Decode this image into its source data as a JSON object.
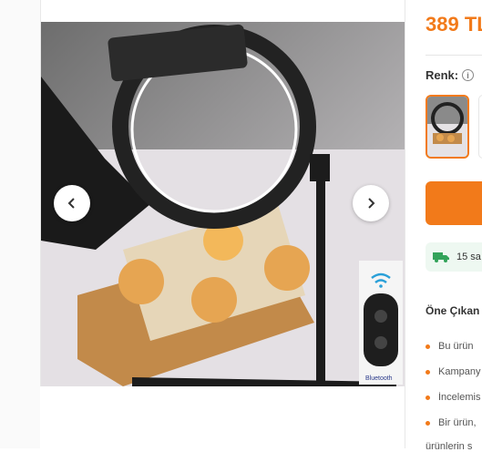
{
  "product": {
    "price": "389 TL",
    "color_label": "Renk:",
    "shipping_text": "15 sa",
    "features_title": "Öne Çıkan",
    "features": [
      "Bu ürün",
      "Kampany",
      "İncelemis",
      "Bir ürün,"
    ],
    "features_tail": "ürünlerin s"
  },
  "gallery": {
    "image_overlay_text": "Bluetooth",
    "prev_icon": "chevron-left-icon",
    "next_icon": "chevron-right-icon"
  },
  "colors": {
    "accent": "#f27a1a",
    "shipping_bg": "#eef8f1",
    "shipping_icon": "#33a35a"
  }
}
